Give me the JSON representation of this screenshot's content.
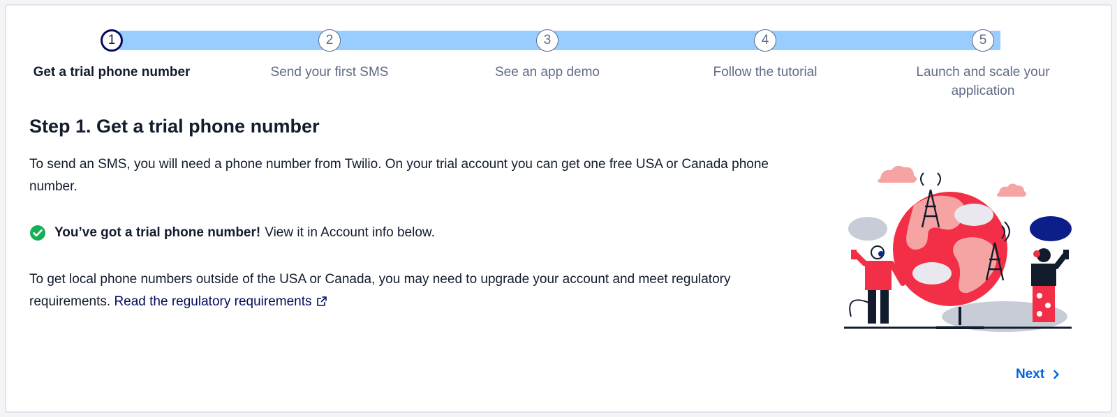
{
  "stepper": {
    "steps": [
      {
        "number": "1",
        "label": "Get a trial phone number",
        "active": true
      },
      {
        "number": "2",
        "label": "Send your first SMS",
        "active": false
      },
      {
        "number": "3",
        "label": "See an app demo",
        "active": false
      },
      {
        "number": "4",
        "label": "Follow the tutorial",
        "active": false
      },
      {
        "number": "5",
        "label": "Launch and scale your application",
        "active": false
      }
    ]
  },
  "main": {
    "title": "Step 1. Get a trial phone number",
    "intro": "To send an SMS, you will need a phone number from Twilio. On your trial account you can get one free USA or Canada phone number.",
    "status": {
      "icon": "check-circle-icon",
      "strong": "You’ve got a trial phone number!",
      "text": "View it in Account info below."
    },
    "regulatory_text": "To get local phone numbers outside of the USA or Canada, you may need to upgrade your account and meet regulatory requirements.",
    "regulatory_link": "Read the regulatory requirements",
    "regulatory_link_icon": "external-link-icon"
  },
  "illustration": {
    "icon": "globe-communication-illustration"
  },
  "footer": {
    "next_label": "Next",
    "next_icon": "chevron-right-icon"
  },
  "colors": {
    "track": "#99cdff",
    "active_step_border": "#030b5d",
    "link": "#0263e0",
    "success": "#14b053",
    "globe": "#f22f46"
  }
}
